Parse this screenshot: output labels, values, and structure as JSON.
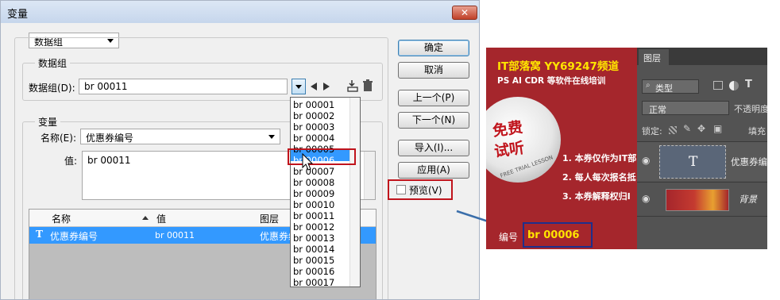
{
  "dialog": {
    "title": "变量",
    "close_glyph": "✕",
    "type_select": "数据组",
    "dataset_group_legend": "数据组",
    "dataset_label": "数据组(D):",
    "dataset_value": "br 00011",
    "variables_legend": "变量",
    "name_label": "名称(E):",
    "name_value": "优惠券编号",
    "value_label": "值:",
    "value_text": "br 00011",
    "table_headers": [
      "名称",
      "值",
      "图层"
    ],
    "table_row": {
      "type_glyph": "T",
      "name": "优惠券编号",
      "value": "br 00011",
      "layer": "优惠券编"
    },
    "buttons": {
      "ok": "确定",
      "cancel": "取消",
      "prev": "上一个(P)",
      "next": "下一个(N)",
      "import": "导入(I)...",
      "apply": "应用(A)"
    },
    "preview_label": "预览(V)"
  },
  "dropdown_items": [
    "br 00001",
    "br 00002",
    "br 00003",
    "br 00004",
    "br 00005",
    "br 00006",
    "br 00007",
    "br 00008",
    "br 00009",
    "br 00010",
    "br 00011",
    "br 00012",
    "br 00013",
    "br 00014",
    "br 00015",
    "br 00016",
    "br 00017"
  ],
  "dropdown_selected": "br 00006",
  "coupon": {
    "header": "IT部落窝 YY69247频道",
    "subheader": "PS AI CDR 等软件在线培训",
    "stamp_line1": "免费",
    "stamp_line2": "试听",
    "stamp_ring": "FREE TRIAL LESSON",
    "rule1": "1. 本券仅作为IT部",
    "rule2": "2. 每人每次报名抵",
    "rule3": "3. 本券解释权归I",
    "number_label": "编号",
    "number_value": "br 00006"
  },
  "layers_panel": {
    "tab": "图层",
    "kind_select": "类型",
    "blend_select": "正常",
    "opacity_label": "不透明度",
    "lock_label": "锁定:",
    "fill_label": "填充",
    "layer1_name": "优惠券编",
    "layer1_glyph": "T",
    "layer2_name": "背景"
  },
  "colors": {
    "dialog_bg": "#f0f0f0",
    "selection_blue": "#3399ff",
    "highlight_red": "#c0141c",
    "coupon_red": "#a5262c",
    "coupon_yellow": "#ffe400",
    "annotation_navy": "#1e2f8c",
    "arrow_blue": "#3a6eaa",
    "ps_panel": "#535353"
  }
}
